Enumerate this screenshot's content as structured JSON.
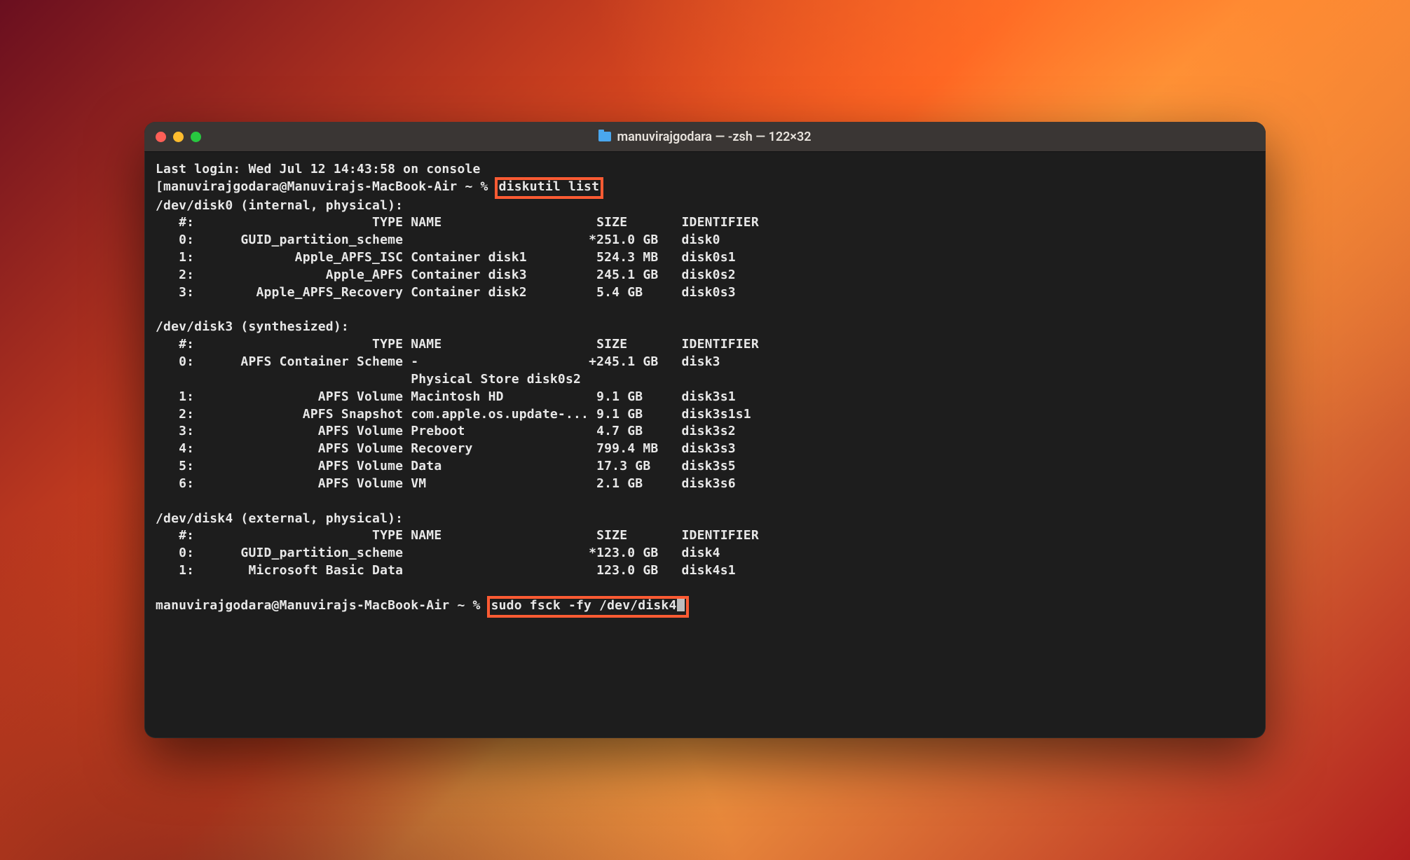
{
  "window": {
    "title": "manuvirajgodara — -zsh — 122×32"
  },
  "last_login": "Last login: Wed Jul 12 14:43:58 on console",
  "prompt1": {
    "prefix": "[manuvirajgodara@Manuvirajs-MacBook-Air ~ % ",
    "cmd": "diskutil list"
  },
  "disk0": {
    "header": "/dev/disk0 (internal, physical):",
    "cols": "   #:                       TYPE NAME                    SIZE       IDENTIFIER",
    "rows": [
      "   0:      GUID_partition_scheme                        *251.0 GB   disk0",
      "   1:             Apple_APFS_ISC Container disk1         524.3 MB   disk0s1",
      "   2:                 Apple_APFS Container disk3         245.1 GB   disk0s2",
      "   3:        Apple_APFS_Recovery Container disk2         5.4 GB     disk0s3"
    ]
  },
  "disk3": {
    "header": "/dev/disk3 (synthesized):",
    "cols": "   #:                       TYPE NAME                    SIZE       IDENTIFIER",
    "rows": [
      "   0:      APFS Container Scheme -                      +245.1 GB   disk3",
      "                                 Physical Store disk0s2",
      "   1:                APFS Volume Macintosh HD            9.1 GB     disk3s1",
      "   2:              APFS Snapshot com.apple.os.update-... 9.1 GB     disk3s1s1",
      "   3:                APFS Volume Preboot                 4.7 GB     disk3s2",
      "   4:                APFS Volume Recovery                799.4 MB   disk3s3",
      "   5:                APFS Volume Data                    17.3 GB    disk3s5",
      "   6:                APFS Volume VM                      2.1 GB     disk3s6"
    ]
  },
  "disk4": {
    "header": "/dev/disk4 (external, physical):",
    "cols": "   #:                       TYPE NAME                    SIZE       IDENTIFIER",
    "rows": [
      "   0:      GUID_partition_scheme                        *123.0 GB   disk4",
      "   1:       Microsoft Basic Data                         123.0 GB   disk4s1"
    ]
  },
  "prompt2": {
    "prefix": "manuvirajgodara@Manuvirajs-MacBook-Air ~ % ",
    "cmd": "sudo fsck -fy /dev/disk4"
  },
  "annotation": {
    "highlight_color": "#ff5b33",
    "highlighted_commands": [
      "diskutil list",
      "sudo fsck -fy /dev/disk4"
    ]
  }
}
